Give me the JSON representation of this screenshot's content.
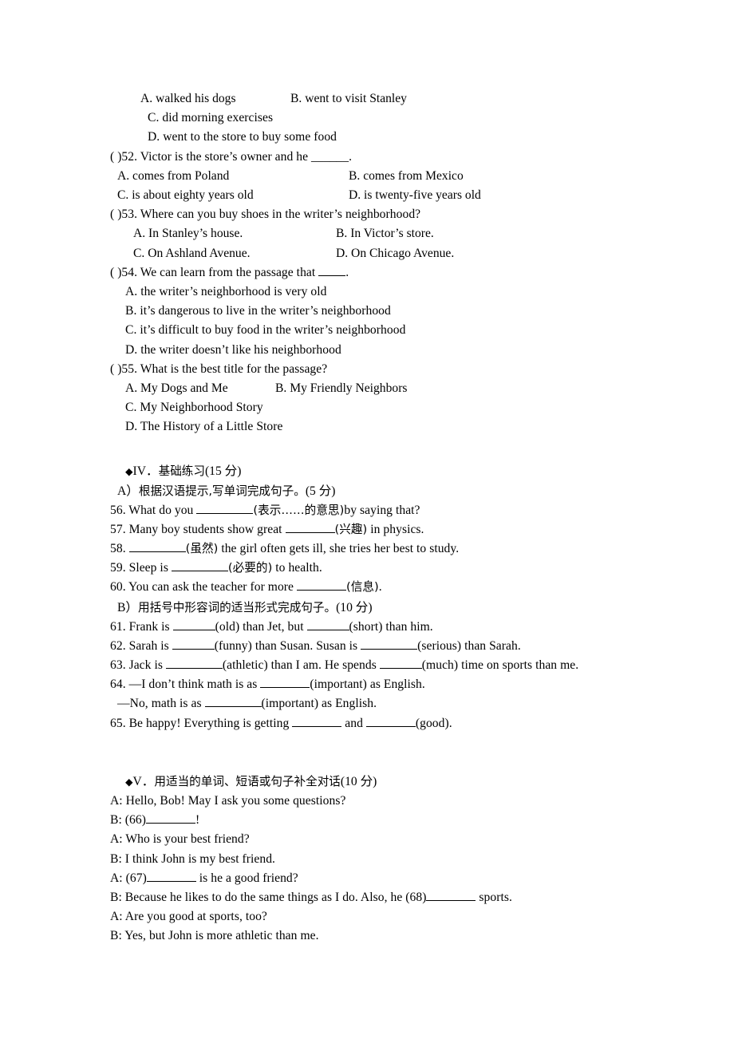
{
  "document": {
    "type": "english-exam-worksheet",
    "language_mix": "English with Chinese instructions"
  },
  "reading_questions": {
    "q51_options_continued": [
      {
        "indent": 4,
        "text": "A. walked his dogs"
      },
      {
        "indent": 4,
        "text": "B. went to visit Stanley"
      },
      {
        "indent": 4,
        "text": "C. did morning exercises"
      },
      {
        "indent": 5,
        "text": "D. went to the store to buy some food"
      }
    ],
    "q51_row1_a": "A. walked his dogs",
    "q51_row1_b": "B. went to visit Stanley",
    "q51_row2": "C. did morning exercises",
    "q51_row3": "D. went to the store to buy some food",
    "q52_stem": "( )52. Victor is the store’s owner and he ______.",
    "q52_a": "A. comes from Poland",
    "q52_b": "B. comes from Mexico",
    "q52_c": "C. is about eighty years old",
    "q52_d": "D. is twenty-five years old",
    "q53_stem": "( )53. Where can you buy shoes in the writer’s neighborhood?",
    "q53_a": "A. In Stanley’s house.",
    "q53_b": "B. In Victor’s store.",
    "q53_c": "C. On Ashland Avenue.",
    "q53_d": "D. On Chicago Avenue.",
    "q54_stem_pre": "( )54. We can learn from the passage that ",
    "q54_stem_post": ".",
    "q54_a": "A. the writer’s neighborhood is very old",
    "q54_b": "B. it’s dangerous to live in the writer’s neighborhood",
    "q54_c": "C. it’s difficult to buy food in the writer’s neighborhood",
    "q54_d": "D. the writer doesn’t like his neighborhood",
    "q55_stem": "( )55. What is the best title for the passage?",
    "q55_a": "A. My Dogs and Me",
    "q55_b": "B. My Friendly Neighbors",
    "q55_c": "C. My Neighborhood Story",
    "q55_d": "D. The History of a Little Store"
  },
  "section_four": {
    "bullet": "◆",
    "heading_roman": "IV．",
    "heading_cn": "基础练习",
    "heading_points": "(15 分)",
    "part_a_label": "A）",
    "part_a_cn": "根据汉语提示,写单词完成句子。",
    "part_a_points": "(5 分)",
    "q56_pre": "56. What do you ",
    "q56_hint": "(表示……的意思)",
    "q56_post": "by saying that?",
    "q57_pre": "57. Many boy students show great ",
    "q57_hint": "(兴趣)",
    "q57_post": " in physics.",
    "q58_pre": "58. ",
    "q58_hint": "(虽然)",
    "q58_post": " the girl often gets ill, she tries her best to study.",
    "q59_pre": "59. Sleep is ",
    "q59_hint": "(必要的)",
    "q59_post": " to health.",
    "q60_pre": "60. You can ask the teacher for more ",
    "q60_hint": "(信息)",
    "q60_post": ".",
    "part_b_label": "B）",
    "part_b_cn": "用括号中形容词的适当形式完成句子。",
    "part_b_points": "(10 分)",
    "q61_p1": "61. Frank is ",
    "q61_p2": "(old) than Jet, but ",
    "q61_p3": "(short) than him.",
    "q62_p1": "62. Sarah is ",
    "q62_p2": "(funny) than Susan. Susan is ",
    "q62_p3": "(serious) than Sarah.",
    "q63_p1": "63. Jack is ",
    "q63_p2": "(athletic) than I am. He spends ",
    "q63_p3": "(much) time on sports than me.",
    "q64_p1": "64. —I don’t think math is as ",
    "q64_p2": "(important) as English.",
    "q64_p3": "—No, math is as ",
    "q64_p4": "(important) as English.",
    "q65_p1": "65. Be happy! Everything is getting ",
    "q65_p2": " and ",
    "q65_p3": "(good)."
  },
  "section_five": {
    "bullet": "◆",
    "heading_roman": "V．",
    "heading_cn": "用适当的单词、短语或句子补全对话",
    "heading_points": "(10 分)",
    "line1": "A: Hello, Bob! May I ask you some questions?",
    "line2_pre": "B: (66)",
    "line2_post": "!",
    "line3": "A: Who is your best friend?",
    "line4": "B: I think John is my best friend.",
    "line5_pre": "A: (67)",
    "line5_post": " is he a good friend?",
    "line6_pre": "B: Because he likes to do the same things as I do. Also, he (68)",
    "line6_post": " sports.",
    "line7": "A: Are you good at sports, too?",
    "line8": "B: Yes, but John is more athletic than me."
  },
  "colors": {
    "page_background": "#ffffff",
    "text": "#000000"
  }
}
